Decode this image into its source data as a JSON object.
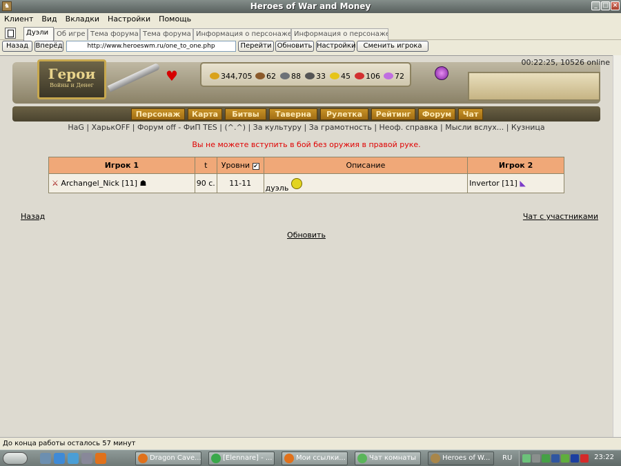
{
  "window": {
    "title": "Heroes of War and Money"
  },
  "menu": [
    "Клиент",
    "Вид",
    "Вкладки",
    "Настройки",
    "Помощь"
  ],
  "tabs": [
    {
      "label": "Дуэли",
      "active": true
    },
    {
      "label": "Об игре"
    },
    {
      "label": "Тема форума"
    },
    {
      "label": "Тема форума"
    },
    {
      "label": "Информация о персонаже"
    },
    {
      "label": "Информация о персонаже"
    }
  ],
  "nav": {
    "back": "Назад",
    "forward": "Вперёд",
    "url": "http://www.heroeswm.ru/one_to_one.php",
    "go": "Перейти",
    "refresh": "Обновить",
    "settings": "Настройки",
    "switch_player": "Сменить игрока"
  },
  "header": {
    "logo_main": "Герои",
    "logo_sub": "Войны и Денег",
    "time_online": "00:22:25, 10526 online",
    "resources": [
      {
        "icon": "gold-icon",
        "value": "344,705",
        "color": "#d9a21c"
      },
      {
        "icon": "wood-icon",
        "value": "62",
        "color": "#8b5a2b"
      },
      {
        "icon": "ore-icon",
        "value": "88",
        "color": "#6d7278"
      },
      {
        "icon": "mercury-icon",
        "value": "33",
        "color": "#555"
      },
      {
        "icon": "sulfur-icon",
        "value": "45",
        "color": "#e6c419"
      },
      {
        "icon": "crystal-icon",
        "value": "106",
        "color": "#d23030"
      },
      {
        "icon": "gems-icon",
        "value": "72",
        "color": "#c06ee0"
      }
    ],
    "game_nav": [
      "Персонаж",
      "Карта",
      "Битвы",
      "Таверна",
      "Рулетка",
      "Рейтинг",
      "Форум",
      "Чат"
    ]
  },
  "links": "HaG | ХарькOFF | Форум off - ФиП TES | (^.^) | За культуру | За грамотность | Неоф. справка | Мысли вслух... | Кузница",
  "warning": "Вы не можете вступить в бой без оружия в правой руке.",
  "table": {
    "headers": {
      "p1": "Игрок 1",
      "t": "t",
      "levels": "Уровни",
      "desc": "Описание",
      "p2": "Игрок 2"
    },
    "rows": [
      {
        "p1": "Archangel_Nick [11]",
        "t": "90 с.",
        "levels": "11-11",
        "desc": "дуэль",
        "p2": "Invertor [11]"
      }
    ]
  },
  "footer_links": {
    "back": "Назад",
    "chat": "Чат с участниками",
    "refresh": "Обновить"
  },
  "status": "До конца работы осталось 57 минут",
  "taskbar": {
    "items": [
      "Dragon Cave...",
      "[Elennare] - ...",
      "Мои ссылки...",
      "Чат комнаты",
      "Heroes of W..."
    ],
    "lang": "RU",
    "clock": "23:22"
  }
}
